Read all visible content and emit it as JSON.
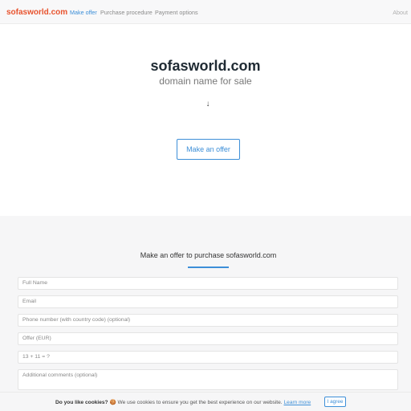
{
  "navbar": {
    "brand": "sofasworld.com",
    "links": [
      "Make offer",
      "Purchase procedure",
      "Payment options"
    ],
    "about": "About"
  },
  "hero": {
    "title": "sofasworld.com",
    "subtitle": "domain name for sale",
    "arrow": "↓",
    "button_label": "Make an offer"
  },
  "form": {
    "title": "Make an offer to purchase sofasworld.com",
    "fields": {
      "full_name": "Full Name",
      "email": "Email",
      "phone": "Phone number (with country code) (optional)",
      "offer": "Offer (EUR)",
      "captcha": "13 + 11 = ?",
      "comments": "Additional comments (optional)"
    }
  },
  "cookie": {
    "question": "Do you like cookies?",
    "emoji": "🍪",
    "message": "We use cookies to ensure you get the best experience on our website.",
    "learn_more": "Learn more",
    "agree": "I agree"
  },
  "colors": {
    "brand": "#e8532e",
    "accent": "#3d8fd8"
  }
}
